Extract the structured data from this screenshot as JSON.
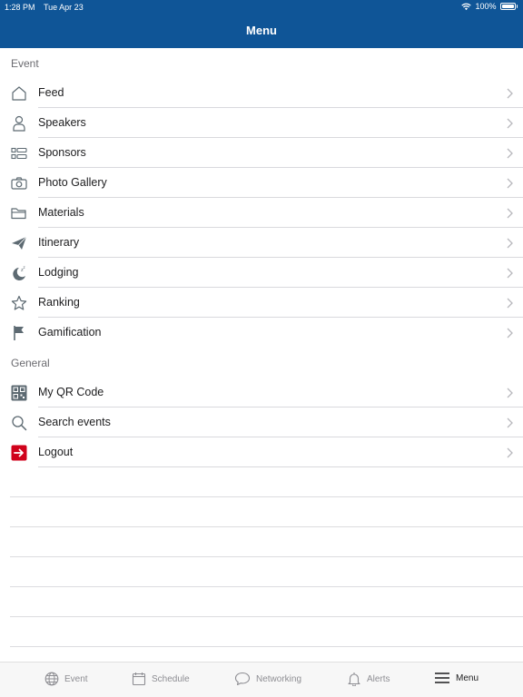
{
  "status_bar": {
    "time": "1:28 PM",
    "date": "Tue Apr 23",
    "battery": "100%"
  },
  "nav": {
    "title": "Menu"
  },
  "sections": [
    {
      "title": "Event",
      "items": [
        {
          "label": "Feed",
          "icon": "home-icon"
        },
        {
          "label": "Speakers",
          "icon": "person-icon"
        },
        {
          "label": "Sponsors",
          "icon": "list-icon"
        },
        {
          "label": "Photo Gallery",
          "icon": "camera-icon"
        },
        {
          "label": "Materials",
          "icon": "folder-icon"
        },
        {
          "label": "Itinerary",
          "icon": "paper-plane-icon"
        },
        {
          "label": "Lodging",
          "icon": "moon-icon"
        },
        {
          "label": "Ranking",
          "icon": "star-icon"
        },
        {
          "label": "Gamification",
          "icon": "flag-icon"
        }
      ]
    },
    {
      "title": "General",
      "items": [
        {
          "label": "My QR Code",
          "icon": "qr-code-icon"
        },
        {
          "label": "Search events",
          "icon": "search-icon"
        },
        {
          "label": "Logout",
          "icon": "logout-icon"
        }
      ]
    }
  ],
  "tabs": [
    {
      "label": "Event",
      "icon": "globe-icon",
      "active": false
    },
    {
      "label": "Schedule",
      "icon": "calendar-icon",
      "active": false
    },
    {
      "label": "Networking",
      "icon": "chat-bubble-icon",
      "active": false
    },
    {
      "label": "Alerts",
      "icon": "bell-icon",
      "active": false
    },
    {
      "label": "Menu",
      "icon": "hamburger-menu-icon",
      "active": true
    }
  ],
  "colors": {
    "header": "#0f5597",
    "icon": "#5d6a72",
    "logout": "#d0021b"
  }
}
